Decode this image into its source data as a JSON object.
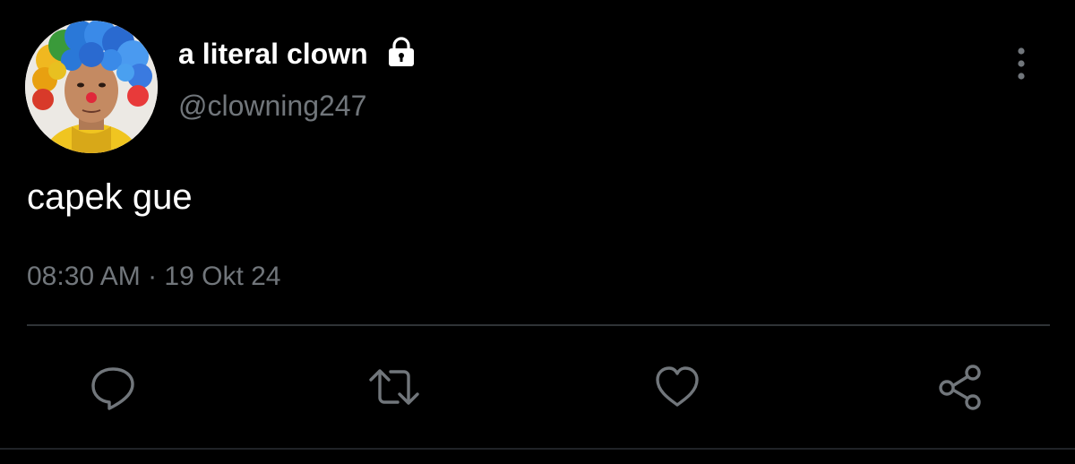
{
  "user": {
    "display_name": "a literal clown",
    "handle": "@clowning247",
    "protected_icon": "lock-icon",
    "avatar": "clown-wig-avatar"
  },
  "tweet": {
    "text": "capek gue",
    "timestamp": "08:30 AM · 19 Okt 24"
  },
  "actions": [
    {
      "name": "reply",
      "icon": "reply-icon"
    },
    {
      "name": "retweet",
      "icon": "retweet-icon"
    },
    {
      "name": "like",
      "icon": "heart-icon"
    },
    {
      "name": "share",
      "icon": "share-icon"
    }
  ],
  "menu": {
    "icon": "more-vertical-icon"
  },
  "colors": {
    "background": "#000000",
    "primary_text": "#ffffff",
    "secondary_text": "#71767b",
    "divider": "#2f3336",
    "icon": "#71767b"
  }
}
